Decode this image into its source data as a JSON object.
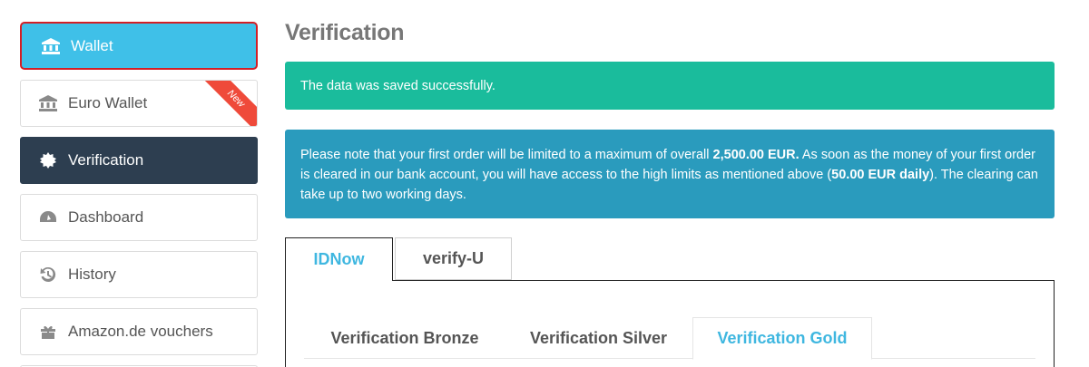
{
  "sidebar": {
    "items": [
      {
        "label": "Wallet",
        "icon": "bank-icon"
      },
      {
        "label": "Euro Wallet",
        "icon": "bank-icon",
        "ribbon": "New"
      },
      {
        "label": "Verification",
        "icon": "gear-badge-icon"
      },
      {
        "label": "Dashboard",
        "icon": "dashboard-icon"
      },
      {
        "label": "History",
        "icon": "history-icon"
      },
      {
        "label": "Amazon.de vouchers",
        "icon": "gift-icon"
      }
    ]
  },
  "main": {
    "title": "Verification",
    "success_message": "The data was saved successfully.",
    "info": {
      "part1": "Please note that your first order will be limited to a maximum of overall ",
      "bold1": "2,500.00 EUR.",
      "part2": " As soon as the money of your first order is cleared in our bank account, you will have access to the high limits as mentioned above (",
      "bold2": "50.00 EUR daily",
      "part3": "). The clearing can take up to two working days."
    },
    "tabs": [
      {
        "label": "IDNow"
      },
      {
        "label": "verify-U"
      }
    ],
    "subtabs": [
      {
        "label": "Verification Bronze"
      },
      {
        "label": "Verification Silver"
      },
      {
        "label": "Verification Gold"
      }
    ]
  },
  "colors": {
    "wallet_bg": "#3fc0e8",
    "active_bg": "#2d3e50",
    "success_bg": "#1abc9c",
    "info_bg": "#2a9bbd",
    "ribbon": "#ef4a3a",
    "tab_active_text": "#3fb7e0"
  }
}
